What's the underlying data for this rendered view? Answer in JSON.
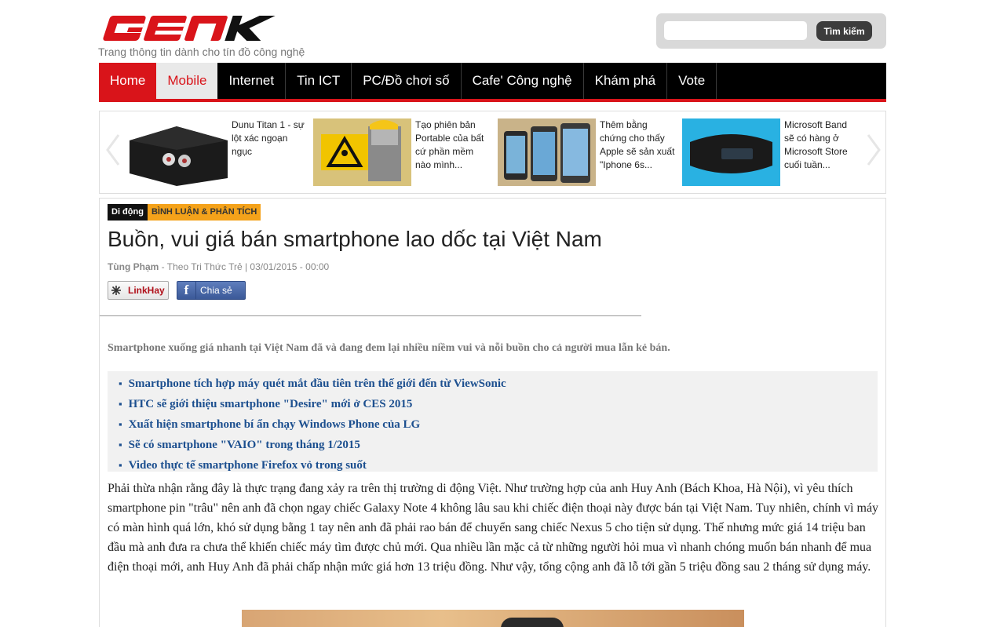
{
  "header": {
    "logo_text": "GENK",
    "tagline": "Trang thông tin dành cho tín đồ công nghệ",
    "search": {
      "placeholder": "",
      "button_label": "Tìm kiếm"
    }
  },
  "nav": {
    "items": [
      {
        "label": "Home"
      },
      {
        "label": "Mobile"
      },
      {
        "label": "Internet"
      },
      {
        "label": "Tin ICT"
      },
      {
        "label": "PC/Đồ chơi số"
      },
      {
        "label": "Cafe' Công nghệ"
      },
      {
        "label": "Khám phá"
      },
      {
        "label": "Vote"
      }
    ],
    "active_index": 1
  },
  "carousel": {
    "slides": [
      {
        "caption": "Dunu Titan 1 - sự lột xác ngoạn ngục"
      },
      {
        "caption": "Tạo phiên bản Portable của bất cứ phần mềm nào mình..."
      },
      {
        "caption": "Thêm bằng chứng cho thấy Apple sẽ sản xuất \"Iphone 6s..."
      },
      {
        "caption": "Microsoft Band sẽ có hàng ở Microsoft Store cuối tuần..."
      }
    ]
  },
  "article": {
    "category": "Di động",
    "subcategory": "BÌNH LUẬN & PHÂN TÍCH",
    "title": "Buồn, vui giá bán smartphone lao dốc tại Việt Nam",
    "author": "Tùng Phạm",
    "source": " - Theo Tri Thức Trẻ | 03/01/2015 - 00:00",
    "share": {
      "linkhay_label": "LinkHay",
      "facebook_label": "Chia sẻ"
    },
    "sapo": "Smartphone xuống giá nhanh tại Việt Nam đã và đang đem lại nhiều niềm vui và nỗi buồn cho cả người mua lẫn kẻ bán.",
    "related": [
      "Smartphone tích hợp máy quét mắt đầu tiên trên thế giới đến từ ViewSonic",
      "HTC sẽ giới thiệu smartphone \"Desire\" mới ở CES 2015",
      "Xuất hiện smartphone bí ẩn chạy Windows Phone của LG",
      "Sẽ có smartphone \"VAIO\" trong tháng 1/2015",
      "Video thực tế smartphone Firefox vỏ trong suốt"
    ],
    "body": "Phải thừa nhận rằng đây là thực trạng đang xảy ra trên thị trường di động Việt. Như trường hợp của anh Huy Anh (Bách Khoa, Hà Nội), vì yêu thích smartphone pin \"trâu\" nên anh đã chọn ngay chiếc Galaxy Note 4 không lâu sau khi chiếc điện thoại này được bán tại Việt Nam. Tuy nhiên, chính vì máy có màn hình quá lớn, khó sử dụng bằng 1 tay nên anh đã phải rao bán để chuyển sang chiếc Nexus 5 cho tiện sử dụng. Thế nhưng mức giá 14 triệu ban đầu mà anh đưa ra chưa thể khiến chiếc máy tìm được chủ mới. Qua nhiều lần mặc cả từ những người hỏi mua vì nhanh chóng muốn bán nhanh để mua điện thoại mới, anh Huy Anh đã phải chấp nhận mức giá hơn 13 triệu đồng. Như vậy, tổng cộng anh đã lỗ tới gần 5 triệu đồng sau 2 tháng sử dụng máy."
  },
  "colors": {
    "brand_red": "#d9141a",
    "nav_bg": "#000000",
    "link_blue": "#1c4f8f",
    "tag_orange": "#f4a21a"
  }
}
